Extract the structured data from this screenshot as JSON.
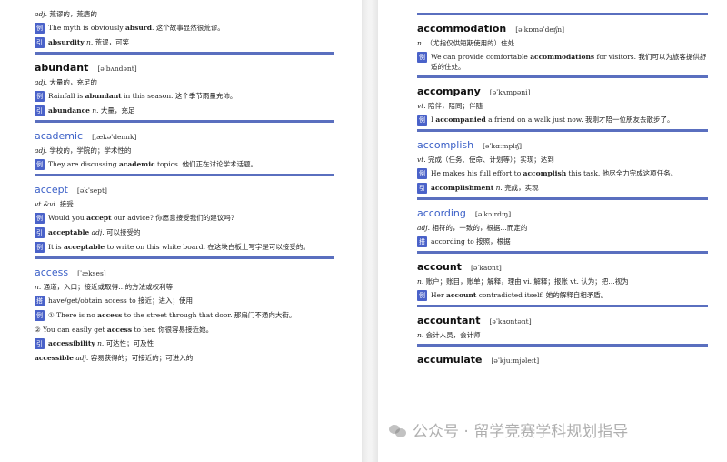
{
  "left": {
    "top_lines": [
      {
        "pos": "adj.",
        "text": "荒谬的，荒唐的"
      },
      {
        "badge": "例",
        "text_pre": "The myth is obviously ",
        "bold": "absurd",
        "text_post": ". 这个故事显然很荒谬。"
      },
      {
        "badge": "引",
        "bold": "absurdity",
        "pos": "n.",
        "text_post": "荒谬，可笑"
      }
    ],
    "entries": [
      {
        "word": "abundant",
        "ipa": "[əˈbʌndənt]",
        "blue": false,
        "lines": [
          {
            "pos": "adj.",
            "text": "大量的，充足的"
          },
          {
            "badge": "例",
            "text_pre": "Rainfall is ",
            "bold": "abundant",
            "text_post": " in this season. 这个季节雨量充沛。"
          },
          {
            "badge": "引",
            "bold": "abundance",
            "pos": "n.",
            "text_post": "大量，充足"
          }
        ]
      },
      {
        "word": "academic",
        "ipa": "[ˌækəˈdemɪk]",
        "blue": true,
        "lines": [
          {
            "pos": "adj.",
            "text": "学校的，学院的；学术性的"
          },
          {
            "badge": "例",
            "text_pre": "They are discussing ",
            "bold": "academic",
            "text_post": " topics. 他们正在讨论学术话题。"
          }
        ]
      },
      {
        "word": "accept",
        "ipa": "[əkˈsept]",
        "blue": true,
        "lines": [
          {
            "pos": "vt.&vi.",
            "text": "接受"
          },
          {
            "badge": "例",
            "text_pre": "Would you ",
            "bold": "accept",
            "text_post": " our advice? 你愿意接受我们的建议吗?"
          },
          {
            "badge": "引",
            "bold": "acceptable",
            "pos": "adj.",
            "text_post": "可以接受的"
          },
          {
            "badge": "例",
            "text_pre": "It is ",
            "bold": "acceptable",
            "text_post": " to write on this white board. 在这块白板上写字是可以接受的。"
          }
        ]
      },
      {
        "word": "access",
        "ipa": "[ˈækses]",
        "blue": true,
        "lines": [
          {
            "pos": "n.",
            "text": "通道，入口；接近或取得…的方法或权利等"
          },
          {
            "badge": "搭",
            "text_pre": "have/get/obtain access to 接近；进入；使用"
          },
          {
            "badge": "例",
            "text_pre": "① There is no ",
            "bold": "access",
            "text_post": " to the street through that door. 那扇门不通向大街。"
          },
          {
            "text_pre": "② You can easily get ",
            "bold": "access",
            "text_post": " to her. 你很容易接近她。"
          },
          {
            "badge": "引",
            "bold": "accessibility",
            "pos": "n.",
            "text_post": "可达性；可及性"
          },
          {
            "bold": "accessible",
            "pos": "adj.",
            "text_post": "容易获得的；可接近的；可进入的"
          }
        ]
      }
    ]
  },
  "right": {
    "entries": [
      {
        "word": "accommodation",
        "ipa": "[əˌkɒməˈdeɪʃn]",
        "blue": false,
        "lines": [
          {
            "pos": "n.",
            "text": "（尤指仅供短期使用的）住处"
          },
          {
            "badge": "例",
            "text_pre": "We can provide comfortable ",
            "bold": "accommodations",
            "text_post": " for visitors. 我们可以为旅客提供舒适的住处。"
          }
        ]
      },
      {
        "word": "accompany",
        "ipa": "[əˈkʌmpəni]",
        "blue": false,
        "lines": [
          {
            "pos": "vt.",
            "text": "陪伴，陪同；伴随"
          },
          {
            "badge": "例",
            "text_pre": "I ",
            "bold": "accompanied",
            "text_post": " a friend on a walk just now. 我刚才陪一位朋友去散步了。"
          }
        ]
      },
      {
        "word": "accomplish",
        "ipa": "[əˈkɑːmplɪʃ]",
        "blue": true,
        "lines": [
          {
            "pos": "vt.",
            "text": "完成（任务、使命、计划等）；实现；达到"
          },
          {
            "badge": "例",
            "text_pre": "He makes his full effort to ",
            "bold": "accomplish",
            "text_post": " this task. 他尽全力完成这项任务。"
          },
          {
            "badge": "引",
            "bold": "accomplishment",
            "pos": "n.",
            "text_post": "完成，实现"
          }
        ]
      },
      {
        "word": "according",
        "ipa": "[əˈkɔːrdɪŋ]",
        "blue": true,
        "lines": [
          {
            "pos": "adj.",
            "text": "相符的，一致的，根据…而定的"
          },
          {
            "badge": "搭",
            "text_pre": "according to 按照，根据"
          }
        ]
      },
      {
        "word": "account",
        "ipa": "[əˈkaʊnt]",
        "blue": false,
        "lines": [
          {
            "pos": "n.",
            "text": "账户；账目，账单；解释，理由 vi. 解释；报账 vt. 认为；把…视为"
          },
          {
            "badge": "例",
            "text_pre": "Her ",
            "bold": "account",
            "text_post": " contradicted itself. 她的解释自相矛盾。"
          }
        ]
      },
      {
        "word": "accountant",
        "ipa": "[əˈkaʊntənt]",
        "blue": false,
        "lines": [
          {
            "pos": "n.",
            "text": "会计人员，会计师"
          }
        ]
      },
      {
        "word": "accumulate",
        "ipa": "[əˈkjuːmjəleɪt]",
        "blue": false,
        "lines": []
      }
    ]
  },
  "watermark": "公众号 · 留学竞赛学科规划指导"
}
